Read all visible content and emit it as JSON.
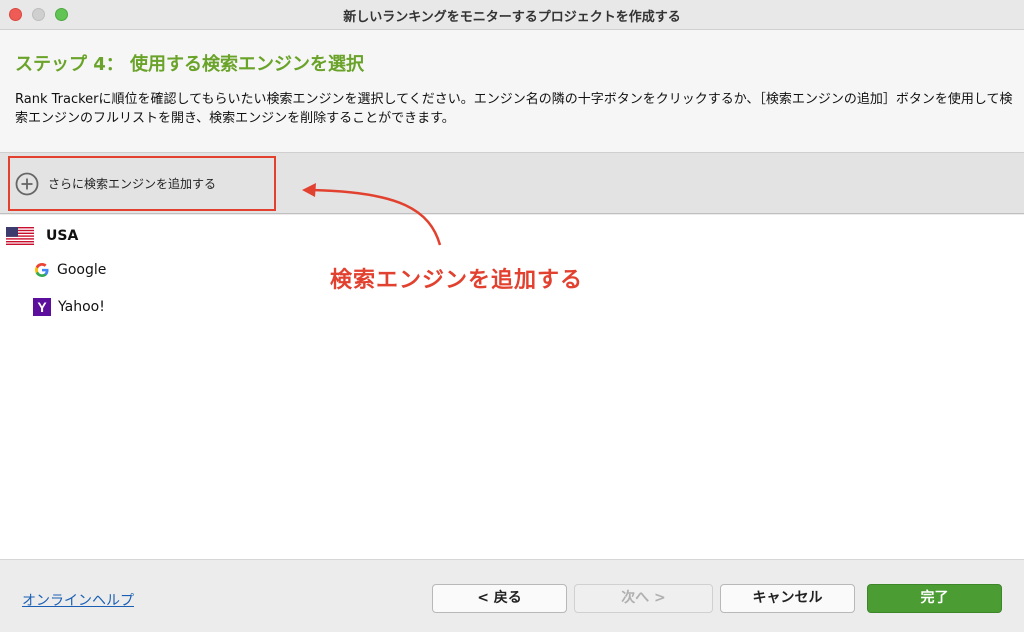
{
  "window": {
    "title": "新しいランキングをモニターするプロジェクトを作成する"
  },
  "header": {
    "step_title": "ステップ 4： 使用する検索エンジンを選択",
    "description": "Rank Trackerに順位を確認してもらいたい検索エンジンを選択してください。エンジン名の隣の十字ボタンをクリックするか、［検索エンジンの追加］ボタンを使用して検索エンジンのフルリストを開き、検索エンジンを削除することができます。"
  },
  "toolbar": {
    "add_engines_label": "さらに検索エンジンを追加する",
    "add_icon": "plus-circle-icon"
  },
  "engines": {
    "country": "USA",
    "country_icon": "us-flag-icon",
    "items": [
      {
        "label": "Google",
        "icon": "google-icon"
      },
      {
        "label": "Yahoo!",
        "icon": "yahoo-icon"
      }
    ]
  },
  "annotation": {
    "text": "検索エンジンを追加する",
    "color": "#e2412f"
  },
  "footer": {
    "help_link": "オンラインヘルプ",
    "back_label": "< 戻る",
    "next_label": "次へ >",
    "cancel_label": "キャンセル",
    "finish_label": "完了"
  },
  "colors": {
    "accent_green": "#6aa329",
    "finish_button": "#4a9c33",
    "highlight_red": "#e2412f",
    "link_blue": "#1a5fb4"
  }
}
